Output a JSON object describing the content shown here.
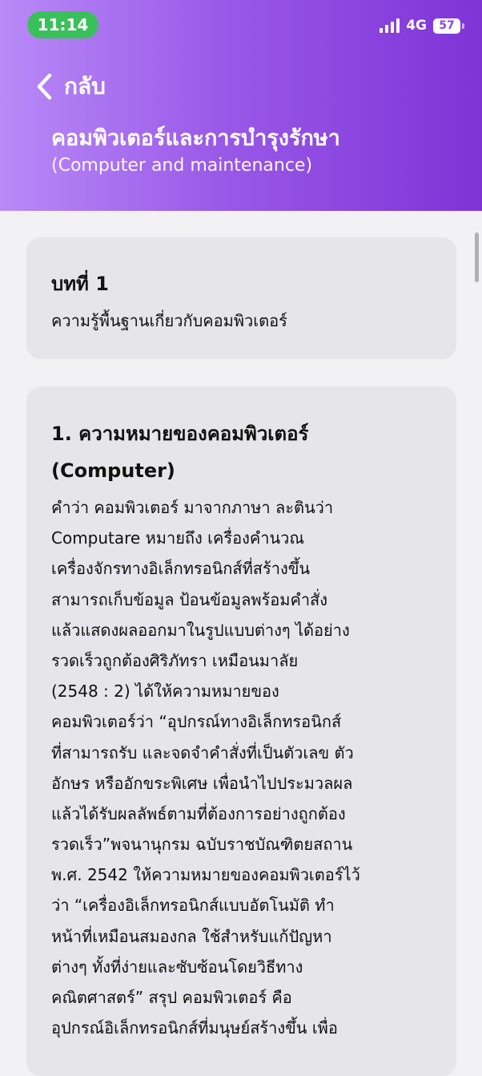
{
  "status_bar": {
    "time": "11:14",
    "network": "4G",
    "battery": "57"
  },
  "header": {
    "back_label": "กลับ",
    "title_th": "คอมพิวเตอร์และการบำรุงรักษา",
    "title_en": "(Computer and maintenance)"
  },
  "chapter_card": {
    "title": "บทที่ 1",
    "subtitle": "ความรู้พื้นฐานเกี่ยวกับคอมพิวเตอร์"
  },
  "content_card": {
    "section_title": "1. ความหมายของคอมพิวเตอร์ (Computer)",
    "lines": [
      "คำว่า คอมพิวเตอร์ มาจากภาษา ละตินว่า",
      "Computare หมายถึง เครื่องคำนวณ",
      "เครื่องจักรทางอิเล็กทรอนิกส์ที่สร้างขึ้น",
      "สามารถเก็บข้อมูล ป้อนข้อมูลพร้อมคำสั่ง",
      "แล้วแสดงผลออกมาในรูปแบบต่างๆ ได้อย่าง",
      "รวดเร็วถูกต้องศิริภัทรา เหมือนมาลัย",
      "(2548 : 2) ได้ให้ความหมายของ",
      "คอมพิวเตอร์ว่า “อุปกรณ์ทางอิเล็กทรอนิกส์",
      "ที่สามารถรับ และจดจำคำสั่งที่เป็นตัวเลข ตัว",
      "อักษร หรืออักขระพิเศษ เพื่อนำไปประมวลผล",
      "แล้วได้รับผลลัพธ์ตามที่ต้องการอย่างถูกต้อง",
      "รวดเร็ว”พจนานุกรม ฉบับราชบัณฑิตยสถาน",
      "พ.ศ. 2542 ให้ความหมายของคอมพิวเตอร์ไว้",
      "ว่า “เครื่องอิเล็กทรอนิกส์แบบอัตโนมัติ ทำ",
      "หน้าที่เหมือนสมองกล ใช้สำหรับแก้ปัญหา",
      "ต่างๆ ทั้งที่ง่ายและซับซ้อนโดยวิธีทาง",
      "คณิตศาสตร์” สรุป คอมพิวเตอร์ คือ",
      "อุปกรณ์อิเล็กทรอนิกส์ที่มนุษย์สร้างขึ้น เพื่อ"
    ]
  }
}
